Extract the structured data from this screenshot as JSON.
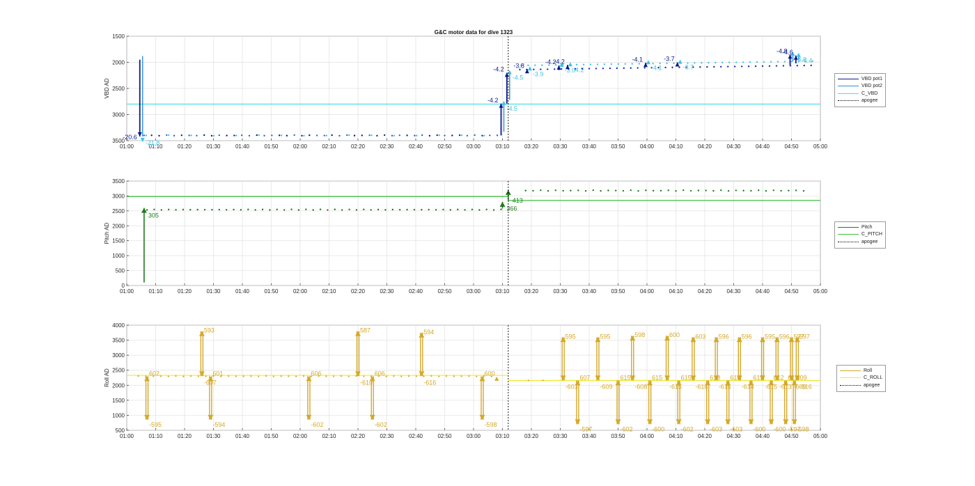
{
  "chart_data": [
    {
      "type": "line",
      "title": "G&C motor data for dive 1323",
      "ylabel": "VBD AD",
      "ylim": [
        1500,
        3500
      ],
      "y_reversed": true,
      "yticks": [
        1500,
        2000,
        2500,
        3000,
        3500
      ],
      "xlim_minutes": [
        60,
        300
      ],
      "xtick_labels": [
        "01:00",
        "01:10",
        "01:20",
        "01:30",
        "01:40",
        "01:50",
        "02:00",
        "02:10",
        "02:20",
        "02:30",
        "02:40",
        "02:50",
        "03:00",
        "03:10",
        "03:20",
        "03:30",
        "03:40",
        "03:50",
        "04:00",
        "04:10",
        "04:20",
        "04:30",
        "04:40",
        "04:50",
        "05:00"
      ],
      "grid": true,
      "legend_position": "outside-right",
      "apogee_time": "03:12",
      "series": [
        {
          "name": "VBD pot1",
          "color": "#0a1a8c"
        },
        {
          "name": "VBD pot2",
          "color": "#2e8fe0"
        },
        {
          "name": "C_VBD",
          "color": "#49e0e6",
          "constant": 2800,
          "after_apogee": 2800
        },
        {
          "name": "apogee",
          "color": "#000000",
          "style": "dotted"
        }
      ],
      "pre_apogee_level": 3400,
      "post_apogee_level_start": 2100,
      "post_apogee_level_end": 2020,
      "events": [
        {
          "time": "01:05",
          "from": 1950,
          "to": 3420,
          "label_pot1": "-20.6",
          "label_pot2": "-21.8"
        },
        {
          "time": "03:10",
          "from": 3400,
          "to": 2790,
          "label_pot1": "-4.2",
          "label_pot2": "-4.5"
        },
        {
          "time": "03:12",
          "from": 2790,
          "to": 2200,
          "label_pot1": "-4.2",
          "label_pot2": "-4.5"
        },
        {
          "time": "03:19",
          "from": 2200,
          "to": 2130,
          "label_pot1": "-3.8",
          "label_pot2": "-3.9"
        },
        {
          "time": "03:30",
          "from": 2150,
          "to": 2060,
          "label_pot1": "-4.2",
          "label_pot2": "-3.0"
        },
        {
          "time": "03:33",
          "from": 2100,
          "to": 2050,
          "label_pot1": "-4.2",
          "label_pot2": "-4.2"
        },
        {
          "time": "04:00",
          "from": 2060,
          "to": 2010,
          "label_pot1": "-4.1",
          "label_pot2": "-4.1"
        },
        {
          "time": "04:11",
          "from": 2060,
          "to": 2000,
          "label_pot1": "-3.7",
          "label_pot2": "-3.7"
        },
        {
          "time": "04:50",
          "from": 2050,
          "to": 1850,
          "label_pot1": "-4.8",
          "label_pot2": "-4.6"
        },
        {
          "time": "04:52",
          "from": 2020,
          "to": 1870,
          "label_pot1": "-4.6",
          "label_pot2": "-4.4"
        }
      ]
    },
    {
      "type": "line",
      "ylabel": "Pitch AD",
      "ylim": [
        0,
        3500
      ],
      "yticks": [
        0,
        500,
        1000,
        1500,
        2000,
        2500,
        3000,
        3500
      ],
      "xlim_minutes": [
        60,
        300
      ],
      "xtick_labels": [
        "01:00",
        "01:10",
        "01:20",
        "01:30",
        "01:40",
        "01:50",
        "02:00",
        "02:10",
        "02:20",
        "02:30",
        "02:40",
        "02:50",
        "03:00",
        "03:10",
        "03:20",
        "03:30",
        "03:40",
        "03:50",
        "04:00",
        "04:10",
        "04:20",
        "04:30",
        "04:40",
        "04:50",
        "05:00"
      ],
      "grid": true,
      "legend_position": "outside-right",
      "apogee_time": "03:12",
      "series": [
        {
          "name": "Pitch",
          "color": "#1f7a1f"
        },
        {
          "name": "C_PITCH",
          "color": "#3fbf3f",
          "constant_before": 2980,
          "constant_after": 2850
        },
        {
          "name": "apogee",
          "color": "#000000",
          "style": "dotted"
        }
      ],
      "pre_apogee_level": 2540,
      "post_apogee_level": 3180,
      "events": [
        {
          "time": "01:06",
          "from": 100,
          "to": 2600,
          "label": "305"
        },
        {
          "time": "03:10",
          "from": 2580,
          "to": 2800,
          "label": "366"
        },
        {
          "time": "03:12",
          "from": 2850,
          "to": 3200,
          "label": "413"
        }
      ]
    },
    {
      "type": "line",
      "ylabel": "Roll AD",
      "ylim": [
        500,
        4000
      ],
      "yticks": [
        500,
        1000,
        1500,
        2000,
        2500,
        3000,
        3500,
        4000
      ],
      "xlim_minutes": [
        60,
        300
      ],
      "xtick_labels": [
        "01:00",
        "01:10",
        "01:20",
        "01:30",
        "01:40",
        "01:50",
        "02:00",
        "02:10",
        "02:20",
        "02:30",
        "02:40",
        "02:50",
        "03:00",
        "03:10",
        "03:20",
        "03:30",
        "03:40",
        "03:50",
        "04:00",
        "04:10",
        "04:20",
        "04:30",
        "04:40",
        "04:50",
        "05:00"
      ],
      "grid": true,
      "legend_position": "outside-right",
      "apogee_time": "03:12",
      "series": [
        {
          "name": "Roll",
          "color": "#d4a82a"
        },
        {
          "name": "C_ROLL",
          "color": "#f2e830",
          "constant_before": 2330,
          "constant_after": 2160
        },
        {
          "name": "apogee",
          "color": "#000000",
          "style": "dotted"
        }
      ],
      "pre_apogee_level": 2300,
      "post_apogee_level": 2160,
      "events": [
        {
          "time": "01:07",
          "from": 2300,
          "to": 850,
          "label_top": "602",
          "label_bottom": "-595",
          "dir": "down"
        },
        {
          "time": "01:26",
          "from": 2300,
          "to": 3800,
          "label_top": "593",
          "label_bottom": "-607",
          "dir": "up"
        },
        {
          "time": "01:29",
          "from": 2300,
          "to": 850,
          "label_top": "601",
          "label_bottom": "-594",
          "dir": "down"
        },
        {
          "time": "02:03",
          "from": 2300,
          "to": 850,
          "label_top": "606",
          "label_bottom": "-602",
          "dir": "down"
        },
        {
          "time": "02:20",
          "from": 2300,
          "to": 3800,
          "label_top": "587",
          "label_bottom": "-610",
          "dir": "up"
        },
        {
          "time": "02:25",
          "from": 2300,
          "to": 850,
          "label_top": "606",
          "label_bottom": "-602",
          "dir": "down"
        },
        {
          "time": "02:42",
          "from": 2300,
          "to": 3750,
          "label_top": "594",
          "label_bottom": "-616",
          "dir": "up"
        },
        {
          "time": "03:03",
          "from": 2300,
          "to": 850,
          "label_top": "600",
          "label_bottom": "-598",
          "dir": "down"
        },
        {
          "time": "03:31",
          "from": 2160,
          "to": 3600,
          "label_top": "595",
          "label_bottom": "-603",
          "dir": "up"
        },
        {
          "time": "03:36",
          "from": 2160,
          "to": 700,
          "label_top": "607",
          "label_bottom": "-597",
          "dir": "down"
        },
        {
          "time": "03:43",
          "from": 2160,
          "to": 3600,
          "label_top": "595",
          "label_bottom": "-609",
          "dir": "up"
        },
        {
          "time": "03:50",
          "from": 2160,
          "to": 700,
          "label_top": "615",
          "label_bottom": "-602",
          "dir": "down"
        },
        {
          "time": "03:55",
          "from": 2160,
          "to": 3650,
          "label_top": "598",
          "label_bottom": "-608",
          "dir": "up"
        },
        {
          "time": "04:01",
          "from": 2160,
          "to": 700,
          "label_top": "615",
          "label_bottom": "-600",
          "dir": "down"
        },
        {
          "time": "04:07",
          "from": 2160,
          "to": 3650,
          "label_top": "600",
          "label_bottom": "-615",
          "dir": "up"
        },
        {
          "time": "04:11",
          "from": 2160,
          "to": 700,
          "label_top": "615",
          "label_bottom": "-602",
          "dir": "down"
        },
        {
          "time": "04:16",
          "from": 2160,
          "to": 3600,
          "label_top": "603",
          "label_bottom": "-616",
          "dir": "up"
        },
        {
          "time": "04:21",
          "from": 2160,
          "to": 700,
          "label_top": "619",
          "label_bottom": "-603",
          "dir": "down"
        },
        {
          "time": "04:24",
          "from": 2160,
          "to": 3600,
          "label_top": "596",
          "label_bottom": "-615",
          "dir": "up"
        },
        {
          "time": "04:28",
          "from": 2160,
          "to": 700,
          "label_top": "614",
          "label_bottom": "-603",
          "dir": "down"
        },
        {
          "time": "04:32",
          "from": 2160,
          "to": 3600,
          "label_top": "596",
          "label_bottom": "-614",
          "dir": "up"
        },
        {
          "time": "04:36",
          "from": 2160,
          "to": 700,
          "label_top": "615",
          "label_bottom": "-600",
          "dir": "down"
        },
        {
          "time": "04:40",
          "from": 2160,
          "to": 3600,
          "label_top": "595",
          "label_bottom": "-615",
          "dir": "up"
        },
        {
          "time": "04:43",
          "from": 2160,
          "to": 700,
          "label_top": "612",
          "label_bottom": "-600",
          "dir": "down"
        },
        {
          "time": "04:45",
          "from": 2160,
          "to": 3600,
          "label_top": "596",
          "label_bottom": "-613",
          "dir": "up"
        },
        {
          "time": "04:48",
          "from": 2160,
          "to": 700,
          "label_top": "613",
          "label_bottom": "-597",
          "dir": "down"
        },
        {
          "time": "04:50",
          "from": 2160,
          "to": 3600,
          "label_top": "597",
          "label_bottom": "-609",
          "dir": "up"
        },
        {
          "time": "04:51",
          "from": 2160,
          "to": 700,
          "label_top": "609",
          "label_bottom": "-598",
          "dir": "down"
        },
        {
          "time": "04:52",
          "from": 2160,
          "to": 3600,
          "label_top": "597",
          "label_bottom": "-616",
          "dir": "up"
        }
      ]
    }
  ]
}
